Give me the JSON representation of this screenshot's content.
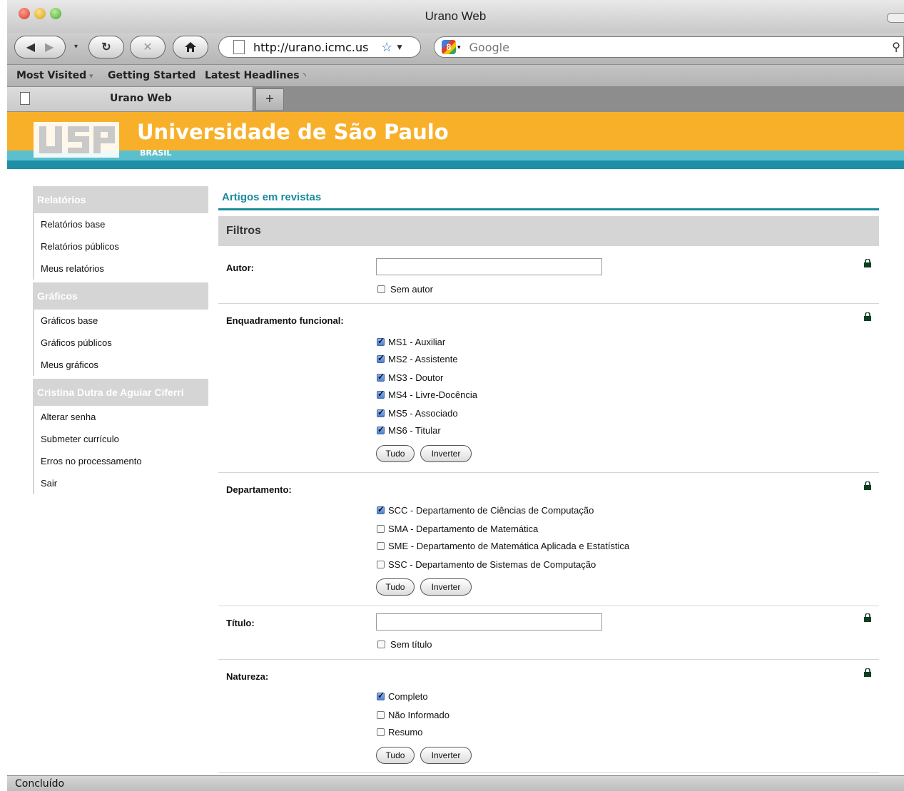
{
  "window": {
    "title": "Urano Web"
  },
  "toolbar": {
    "url": "http://urano.icmc.us",
    "search_placeholder": "Google"
  },
  "bookmarks": [
    "Most Visited",
    "Getting Started",
    "Latest Headlines"
  ],
  "tab": {
    "label": "Urano Web"
  },
  "header": {
    "university": "Universidade de São Paulo",
    "country": "BRASIL"
  },
  "sidebar": {
    "sections": [
      {
        "title": "Relatórios",
        "items": [
          "Relatórios base",
          "Relatórios públicos",
          "Meus relatórios"
        ]
      },
      {
        "title": "Gráficos",
        "items": [
          "Gráficos base",
          "Gráficos públicos",
          "Meus gráficos"
        ]
      },
      {
        "title": "Cristina Dutra de Aguiar Ciferri",
        "items": [
          "Alterar senha",
          "Submeter currículo",
          "Erros no processamento",
          "Sair"
        ]
      }
    ]
  },
  "main": {
    "title": "Artigos em revistas",
    "filters_title": "Filtros",
    "author": {
      "label": "Autor:",
      "value": "",
      "no_value_label": "Sem autor",
      "no_value_checked": false
    },
    "enquadramento": {
      "label": "Enquadramento funcional:",
      "options": [
        {
          "label": "MS1 - Auxiliar",
          "checked": true
        },
        {
          "label": "MS2 - Assistente",
          "checked": true
        },
        {
          "label": "MS3 - Doutor",
          "checked": true
        },
        {
          "label": "MS4 - Livre-Docência",
          "checked": true
        },
        {
          "label": "MS5 - Associado",
          "checked": true
        },
        {
          "label": "MS6 - Titular",
          "checked": true
        }
      ]
    },
    "departamento": {
      "label": "Departamento:",
      "options": [
        {
          "label": "SCC - Departamento de Ciências de Computação",
          "checked": true
        },
        {
          "label": "SMA - Departamento de Matemática",
          "checked": false
        },
        {
          "label": "SME - Departamento de Matemática Aplicada e Estatística",
          "checked": false
        },
        {
          "label": "SSC - Departamento de Sistemas de Computação",
          "checked": false
        }
      ]
    },
    "titulo": {
      "label": "Título:",
      "value": "",
      "no_value_label": "Sem título",
      "no_value_checked": false
    },
    "natureza": {
      "label": "Natureza:",
      "options": [
        {
          "label": "Completo",
          "checked": true
        },
        {
          "label": "Não Informado",
          "checked": false
        },
        {
          "label": "Resumo",
          "checked": false
        }
      ]
    },
    "buttons": {
      "all": "Tudo",
      "invert": "Inverter"
    }
  },
  "status": {
    "text": "Concluído"
  }
}
